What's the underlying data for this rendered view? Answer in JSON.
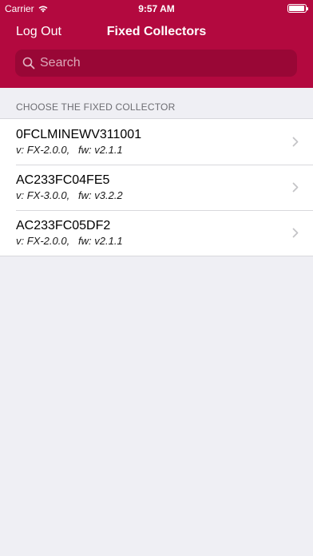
{
  "status_bar": {
    "carrier": "Carrier",
    "time": "9:57 AM"
  },
  "nav": {
    "left_button": "Log Out",
    "title": "Fixed Collectors"
  },
  "search": {
    "placeholder": "Search",
    "value": ""
  },
  "section": {
    "header": "CHOOSE THE FIXED COLLECTOR"
  },
  "collectors": [
    {
      "name": "0FCLMINEWV311001",
      "detail": "v: FX-2.0.0,   fw: v2.1.1"
    },
    {
      "name": "AC233FC04FE5",
      "detail": "v: FX-3.0.0,   fw: v3.2.2"
    },
    {
      "name": "AC233FC05DF2",
      "detail": "v: FX-2.0.0,   fw: v2.1.1"
    }
  ],
  "colors": {
    "brand": "#b3093f",
    "background": "#efeff4"
  },
  "icons": {
    "wifi": "wifi-icon",
    "battery": "battery-icon",
    "search": "search-icon",
    "chevron": "chevron-right-icon"
  }
}
